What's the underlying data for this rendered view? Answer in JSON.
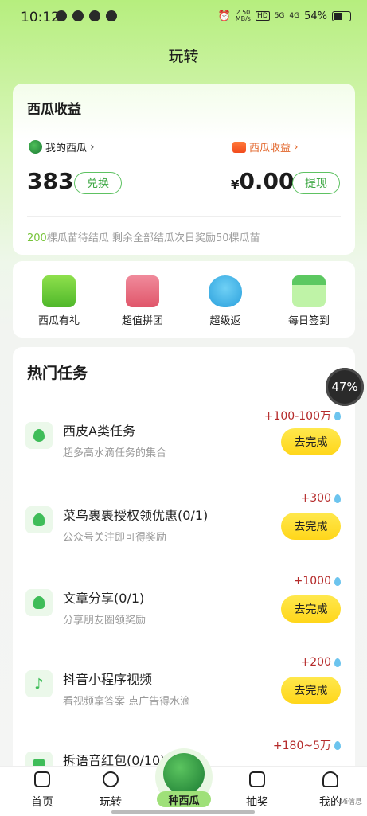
{
  "status_bar": {
    "time": "10:12",
    "net_speed_value": "2.50",
    "net_speed_unit": "MB/s",
    "hd": "HD",
    "signal1": "5G",
    "signal2": "4G",
    "battery": "54%"
  },
  "header": {
    "title": "玩转"
  },
  "earnings_card": {
    "title": "西瓜收益",
    "my_melons_label": "我的西瓜",
    "melon_earnings_label": "西瓜收益",
    "melon_count": "383",
    "exchange_button": "兑换",
    "currency": "¥",
    "amount": "0.00",
    "withdraw_button": "提现",
    "hint_number": "200",
    "hint_text": "棵瓜苗待结瓜 剩余全部结瓜次日奖励50棵瓜苗"
  },
  "entries": [
    {
      "label": "西瓜有礼",
      "icon": "gift-icon"
    },
    {
      "label": "超值拼团",
      "icon": "shopping-bag-icon"
    },
    {
      "label": "超级返",
      "icon": "water-drop-hand-icon"
    },
    {
      "label": "每日签到",
      "icon": "calendar-icon"
    }
  ],
  "tasks_section": {
    "title": "热门任务",
    "progress_badge": "47%",
    "action_label": "去完成",
    "items": [
      {
        "title": "西皮A类任务",
        "subtitle": "超多高水滴任务的集合",
        "reward": "+100-100万",
        "icon": "water-drop-icon"
      },
      {
        "title": "菜鸟裹裹授权领优惠(0/1)",
        "subtitle": "公众号关注即可得奖励",
        "reward": "+300",
        "icon": "user-add-icon"
      },
      {
        "title": "文章分享(0/1)",
        "subtitle": "分享朋友圈领奖励",
        "reward": "+1000",
        "icon": "user-add-icon"
      },
      {
        "title": "抖音小程序视频",
        "subtitle": "看视频拿答案 点广告得水滴",
        "reward": "+200",
        "icon": "tiktok-icon"
      },
      {
        "title": "拆语音红包(0/10)",
        "subtitle": "",
        "reward": "+180~5万",
        "icon": "voice-icon"
      }
    ]
  },
  "bottom_nav": {
    "home": "首页",
    "play": "玩转",
    "plant": "种西瓜",
    "lottery": "抽奖",
    "mine": "我的"
  },
  "watermark": "Mi信息"
}
